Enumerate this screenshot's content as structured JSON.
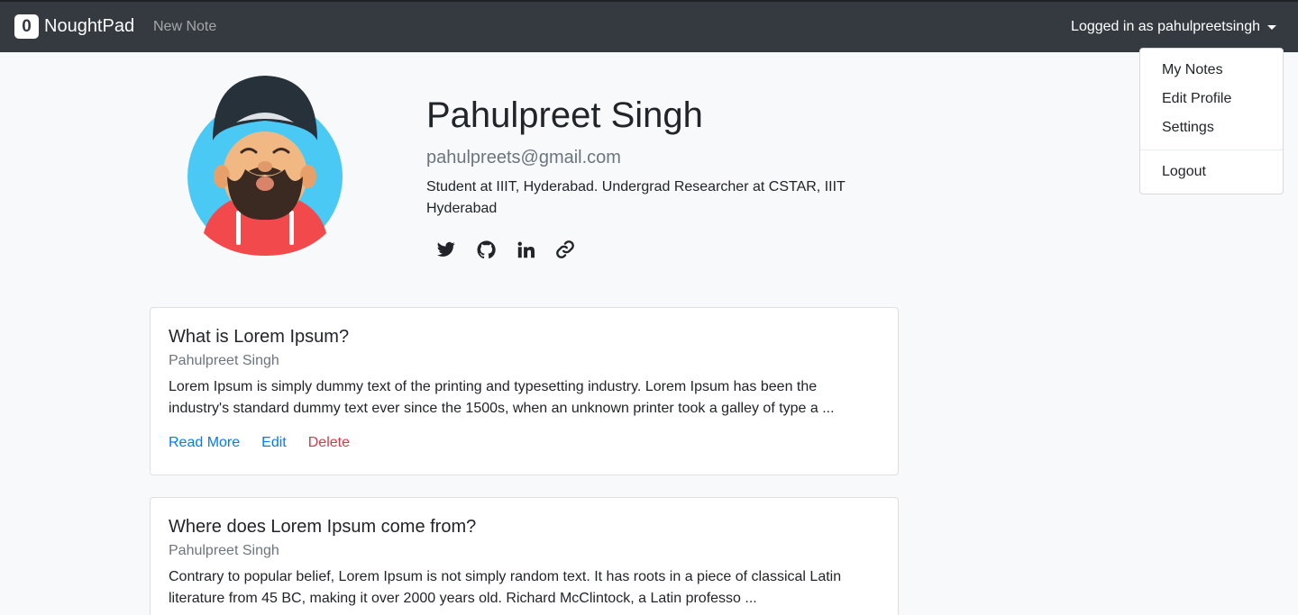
{
  "navbar": {
    "brand_logo": "0",
    "brand": "NoughtPad",
    "new_note": "New Note",
    "user_toggle": "Logged in as pahulpreetsingh"
  },
  "dropdown": {
    "items": [
      "My Notes",
      "Edit Profile",
      "Settings"
    ],
    "logout": "Logout"
  },
  "profile": {
    "name": "Pahulpreet Singh",
    "email": "pahulpreets@gmail.com",
    "bio": "Student at IIIT, Hyderabad. Undergrad Researcher at CSTAR, IIIT Hyderabad",
    "socials": [
      "twitter-icon",
      "github-icon",
      "linkedin-icon",
      "link-icon"
    ]
  },
  "notes": [
    {
      "title": "What is Lorem Ipsum?",
      "author": "Pahulpreet Singh",
      "excerpt": "Lorem Ipsum is simply dummy text of the printing and typesetting industry. Lorem Ipsum has been the industry's standard dummy text ever since the 1500s, when an unknown printer took a galley of type a ...",
      "read_more": "Read More",
      "edit": "Edit",
      "delete": "Delete"
    },
    {
      "title": "Where does Lorem Ipsum come from?",
      "author": "Pahulpreet Singh",
      "excerpt": "Contrary to popular belief, Lorem Ipsum is not simply random text. It has roots in a piece of classical Latin literature from 45 BC, making it over 2000 years old. Richard McClintock, a Latin professo ..."
    }
  ],
  "colors": {
    "navbar": "#343a40",
    "link": "#007bff",
    "danger": "#dc3545",
    "muted": "#6c757d"
  }
}
